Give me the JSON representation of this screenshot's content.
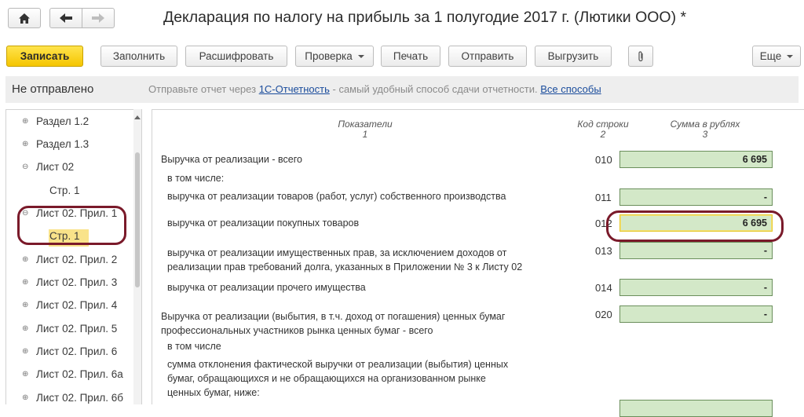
{
  "header": {
    "title": "Декларация по налогу на прибыль за 1 полугодие 2017 г. (Лютики ООО) *"
  },
  "toolbar": {
    "save": "Записать",
    "fill": "Заполнить",
    "decode": "Расшифровать",
    "check": "Проверка",
    "print": "Печать",
    "send": "Отправить",
    "export": "Выгрузить",
    "more": "Еще"
  },
  "status": {
    "state": "Не отправлено",
    "message_prefix": "Отправьте отчет через",
    "link_service": "1С-Отчетность",
    "message_suffix": "- самый удобный способ сдачи отчетности.",
    "link_all": "Все способы"
  },
  "tree": {
    "items": [
      {
        "label": "Раздел 1.2",
        "toggle": "⊕"
      },
      {
        "label": "Раздел 1.3",
        "toggle": "⊕"
      },
      {
        "label": "Лист 02",
        "toggle": "⊖"
      },
      {
        "label": "Стр. 1",
        "toggle": ""
      },
      {
        "label": "Лист 02. Прил. 1",
        "toggle": "⊖"
      },
      {
        "label": "Стр. 1",
        "toggle": ""
      },
      {
        "label": "Лист 02. Прил. 2",
        "toggle": "⊕"
      },
      {
        "label": "Лист 02. Прил. 3",
        "toggle": "⊕"
      },
      {
        "label": "Лист 02. Прил. 4",
        "toggle": "⊕"
      },
      {
        "label": "Лист 02. Прил. 5",
        "toggle": "⊕"
      },
      {
        "label": "Лист 02. Прил. 6",
        "toggle": "⊕"
      },
      {
        "label": "Лист 02. Прил. 6а",
        "toggle": "⊕"
      },
      {
        "label": "Лист 02. Прил. 6б",
        "toggle": "⊕"
      }
    ]
  },
  "form": {
    "col_indicators": "Показатели",
    "col_indicators_num": "1",
    "col_code": "Код строки",
    "col_code_num": "2",
    "col_sum": "Сумма в рублях",
    "col_sum_num": "3",
    "rows": [
      {
        "label": "Выручка от реализации - всего",
        "code": "010",
        "value": "6 695"
      },
      {
        "label": "в том числе:",
        "code": "",
        "value": ""
      },
      {
        "label": "выручка от реализации товаров (работ, услуг) собственного производства",
        "code": "011",
        "value": "-"
      },
      {
        "label": "выручка от реализации покупных товаров",
        "code": "012",
        "value": "6 695"
      },
      {
        "label_line1": "выручка от реализации имущественных прав, за исключением доходов от",
        "label_line2": "реализации прав требований долга, указанных в Приложении № 3 к Листу 02",
        "code": "013",
        "value": "-"
      },
      {
        "label": "выручка от реализации прочего имущества",
        "code": "014",
        "value": "-"
      },
      {
        "label_line1": "Выручка от реализации (выбытия, в т.ч. доход от погашения) ценных бумаг",
        "label_line2": "профессиональных участников рынка ценных бумаг - всего",
        "code": "020",
        "value": "-"
      },
      {
        "label": "в том числе",
        "code": "",
        "value": ""
      },
      {
        "label_line1": "сумма отклонения фактической выручки от реализации (выбытия) ценных",
        "label_line2": "бумаг, обращающихся и не обращающихся на организованном рынке",
        "label_line3": "ценных бумаг, ниже:",
        "code": "",
        "value": ""
      }
    ]
  },
  "icons": {
    "home": "home-icon",
    "back": "arrow-left-icon",
    "forward": "arrow-right-icon",
    "attach": "paperclip-icon"
  },
  "colors": {
    "primary_button": "#f5c500",
    "amount_field": "#d3e8c8",
    "annotation": "#7a1a2a",
    "link": "#1a4c9c",
    "selection": "#f9e38a"
  }
}
